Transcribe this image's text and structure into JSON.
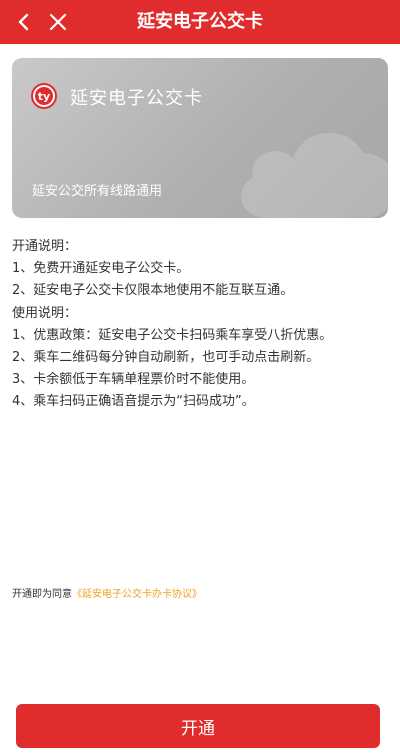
{
  "header": {
    "title": "延安电子公交卡",
    "back_icon": "chevron-left-icon",
    "close_icon": "close-icon"
  },
  "card": {
    "title": "延安电子公交卡",
    "subtitle": "延安公交所有线路通用",
    "logo_text": "ty"
  },
  "instructions": {
    "open_heading": "开通说明：",
    "open_items": [
      "1、免费开通延安电子公交卡。",
      "2、延安电子公交卡仅限本地使用不能互联互通。"
    ],
    "use_heading": "使用说明：",
    "use_items": [
      "1、优惠政策：延安电子公交卡扫码乘车享受八折优惠。",
      "2、乘车二维码每分钟自动刷新，也可手动点击刷新。",
      "3、卡余额低于车辆单程票价时不能使用。",
      "4、乘车扫码正确语音提示为“扫码成功”。"
    ]
  },
  "agreement": {
    "prefix": "开通即为同意",
    "link": "《延安电子公交卡办卡协议》"
  },
  "action": {
    "button_label": "开通"
  },
  "colors": {
    "brand_red": "#e02c2c",
    "link_orange": "#f0a020",
    "card_gray": "#b0b0b0"
  }
}
